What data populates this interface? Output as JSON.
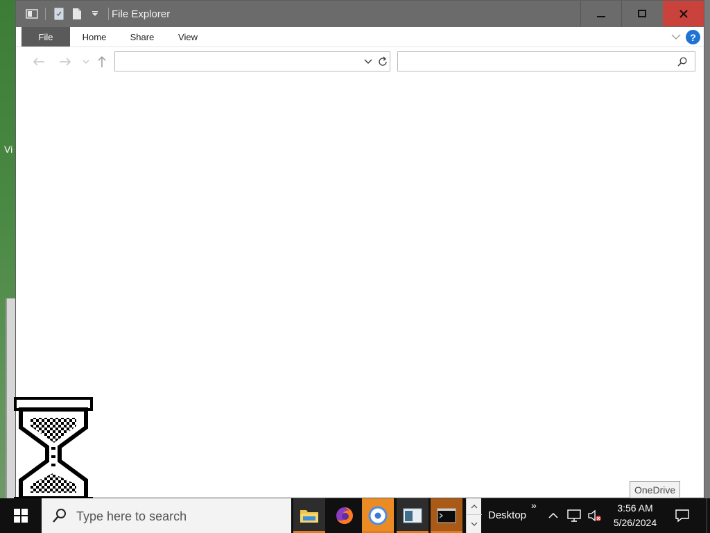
{
  "desktop": {
    "peek_text": "Vi"
  },
  "window": {
    "title": "File Explorer",
    "quick_access": {
      "properties_icon": "properties-icon",
      "new_folder_icon": "new-folder-icon",
      "customize_icon": "chevron-down-icon"
    },
    "controls": {
      "minimize_icon": "minimize-icon",
      "maximize_icon": "maximize-icon",
      "close_icon": "close-icon"
    },
    "ribbon": {
      "tabs": [
        "File",
        "Home",
        "Share",
        "View"
      ],
      "help_label": "?"
    },
    "navigation": {
      "back_icon": "arrow-left-icon",
      "forward_icon": "arrow-right-icon",
      "recent_icon": "chevron-down-icon",
      "up_icon": "arrow-up-icon"
    },
    "address": {
      "value": ""
    },
    "search": {
      "value": "",
      "placeholder": ""
    }
  },
  "tooltip": {
    "text": "OneDrive"
  },
  "taskbar": {
    "search_placeholder": "Type here to search",
    "apps": [
      {
        "name": "File Explorer",
        "icon": "folder-icon"
      },
      {
        "name": "Firefox",
        "icon": "firefox-icon"
      },
      {
        "name": "Chrome",
        "icon": "chrome-icon"
      },
      {
        "name": "App",
        "icon": "window-app-icon"
      },
      {
        "name": "Terminal",
        "icon": "terminal-icon"
      }
    ],
    "toolbar_label": "Desktop",
    "toolbar_chevron": "»",
    "clock": {
      "time": "3:56 AM",
      "date": "5/26/2024"
    }
  },
  "colors": {
    "titlebar": "#6b6b6b",
    "close_hover": "#c9423c",
    "file_tab": "#5a5a5a",
    "help": "#1e74d3",
    "taskbar": "#101010",
    "running_accent": "#e17c20"
  }
}
